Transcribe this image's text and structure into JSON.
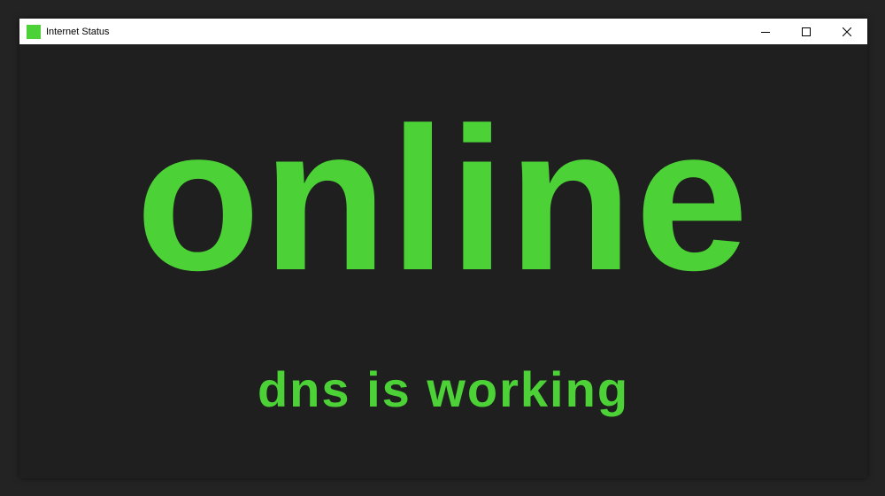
{
  "window": {
    "title": "Internet Status",
    "icon": "green-square-icon",
    "controls": [
      "minimize-icon",
      "maximize-icon",
      "close-icon"
    ]
  },
  "status": {
    "main_text": "online",
    "sub_text": "dns is working"
  },
  "colors": {
    "accent": "#4cd137",
    "background": "#1f1f1f",
    "titlebar": "#ffffff"
  }
}
